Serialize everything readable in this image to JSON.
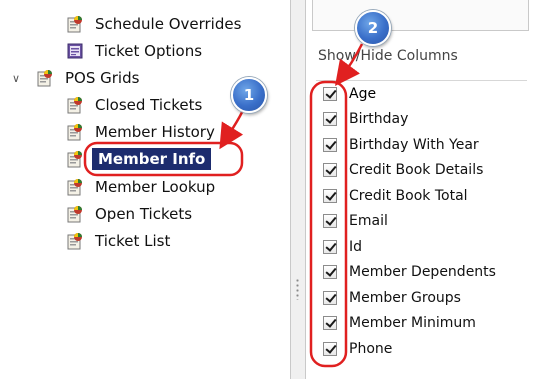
{
  "tree": {
    "items": [
      {
        "label": "Schedule Overrides",
        "icon": "report-icon"
      },
      {
        "label": "Ticket Options",
        "icon": "options-icon"
      },
      {
        "label": "POS Grids",
        "icon": "report-icon",
        "expanded": true
      },
      {
        "label": "Closed Tickets",
        "icon": "report-icon"
      },
      {
        "label": "Member History",
        "icon": "report-icon"
      },
      {
        "label": "Member Info",
        "icon": "report-icon",
        "selected": true
      },
      {
        "label": "Member Lookup",
        "icon": "report-icon"
      },
      {
        "label": "Open Tickets",
        "icon": "report-icon"
      },
      {
        "label": "Ticket List",
        "icon": "report-icon"
      }
    ]
  },
  "panel": {
    "section_label": "Show/Hide Columns",
    "columns": [
      {
        "label": "Age",
        "checked": true
      },
      {
        "label": "Birthday",
        "checked": true
      },
      {
        "label": "Birthday With Year",
        "checked": true
      },
      {
        "label": "Credit Book Details",
        "checked": true
      },
      {
        "label": "Credit Book Total",
        "checked": true
      },
      {
        "label": "Email",
        "checked": true
      },
      {
        "label": "Id",
        "checked": true
      },
      {
        "label": "Member Dependents",
        "checked": true
      },
      {
        "label": "Member Groups",
        "checked": true
      },
      {
        "label": "Member Minimum",
        "checked": true
      },
      {
        "label": "Phone",
        "checked": true
      }
    ]
  },
  "annotations": {
    "step1": "1",
    "step2": "2",
    "color": "#e02020"
  }
}
